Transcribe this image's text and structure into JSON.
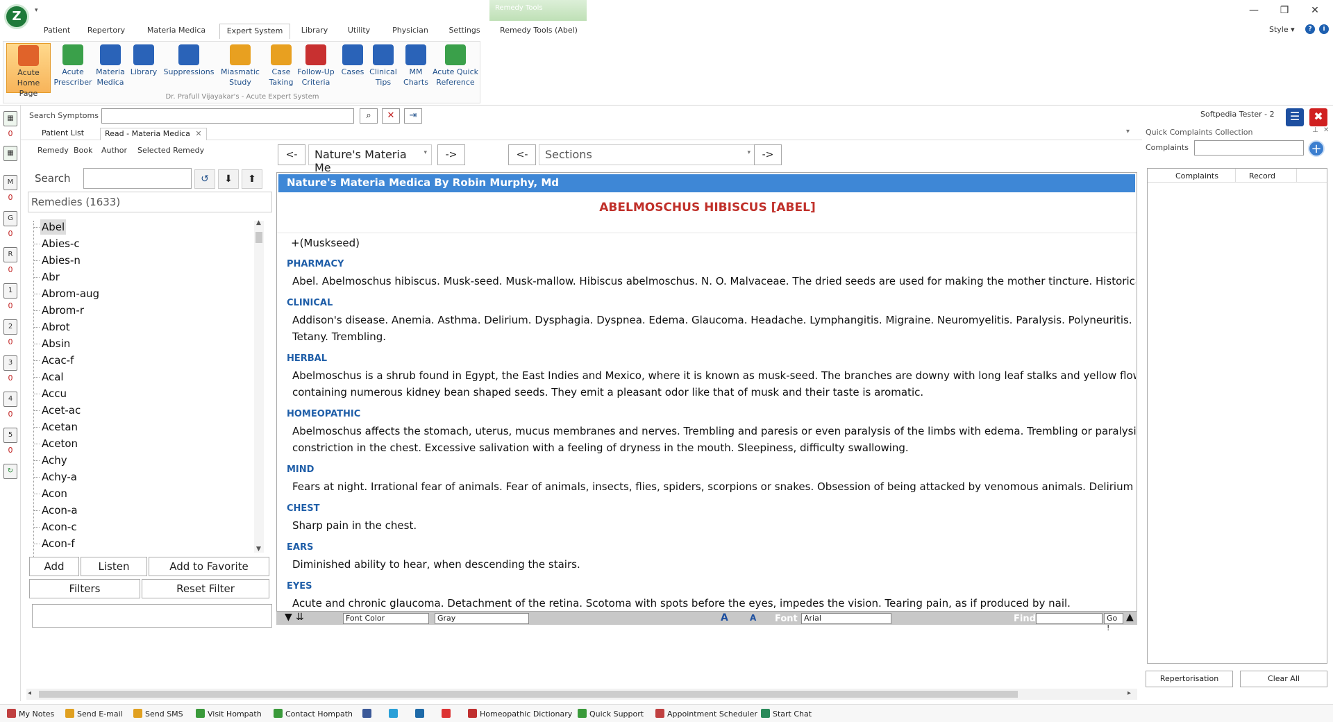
{
  "app": {
    "menu_tabs": [
      "Patient",
      "Repertory",
      "Materia Medica",
      "Expert System",
      "Library",
      "Utility",
      "Physician",
      "Settings",
      "Remedy Tools (Abel)"
    ],
    "active_tab": "Expert System",
    "context_group": "Remedy Tools",
    "style_label": "Style",
    "window_controls": [
      "minimize-icon",
      "restore-icon",
      "close-icon"
    ]
  },
  "ribbon": {
    "buttons": [
      {
        "label": "Acute\nHome Page",
        "icon": "home-page-icon",
        "color": "#e0632a"
      },
      {
        "label": "Acute\nPrescriber",
        "icon": "prescriber-icon",
        "color": "#3aa04a"
      },
      {
        "label": "Materia\nMedica",
        "icon": "materia-medica-icon",
        "color": "#2a63b8"
      },
      {
        "label": "Library",
        "icon": "library-icon",
        "color": "#2a63b8"
      },
      {
        "label": "Suppressions",
        "icon": "suppressions-icon",
        "color": "#2a63b8"
      },
      {
        "label": "Miasmatic\nStudy",
        "icon": "miasmatic-icon",
        "color": "#e8a020"
      },
      {
        "label": "Case\nTaking",
        "icon": "case-taking-icon",
        "color": "#e8a020"
      },
      {
        "label": "Follow-Up\nCriteria",
        "icon": "follow-up-icon",
        "color": "#c83030"
      },
      {
        "label": "Cases",
        "icon": "cases-icon",
        "color": "#2a63b8"
      },
      {
        "label": "Clinical\nTips",
        "icon": "clinical-tips-icon",
        "color": "#2a63b8"
      },
      {
        "label": "MM\nCharts",
        "icon": "mm-charts-icon",
        "color": "#2a63b8"
      },
      {
        "label": "Acute Quick\nReference",
        "icon": "quick-reference-icon",
        "color": "#3aa04a"
      }
    ],
    "caption": "Dr. Prafull Vijayakar's - Acute Expert System"
  },
  "search_symptoms": {
    "label": "Search Symptoms",
    "value": "",
    "user": "Softpedia Tester - 2"
  },
  "left_bar_counts": [
    "0",
    "0",
    "0",
    "0",
    "0",
    "0",
    "0",
    "0",
    "0"
  ],
  "left_bar_icons": [
    "M",
    "G",
    "R",
    "1",
    "2",
    "3",
    "4",
    "5"
  ],
  "doc_tabs": [
    "Patient List",
    "Read - Materia Medica"
  ],
  "sub_tabs": [
    "Remedy",
    "Book",
    "Author",
    "Selected Remedy"
  ],
  "left_panel": {
    "search_label": "Search",
    "remedies_header": "Remedies (1633)",
    "remedies": [
      "Abel",
      "Abies-c",
      "Abies-n",
      "Abr",
      "Abrom-aug",
      "Abrom-r",
      "Abrot",
      "Absin",
      "Acac-f",
      "Acal",
      "Accu",
      "Acet-ac",
      "Acetan",
      "Aceton",
      "Achy",
      "Achy-a",
      "Acon",
      "Acon-a",
      "Acon-c",
      "Acon-f"
    ],
    "selected": "Abel",
    "buttons": {
      "add": "Add",
      "listen": "Listen",
      "favorite": "Add to Favorite",
      "filters": "Filters",
      "reset": "Reset Filter"
    }
  },
  "viewer_nav": {
    "prev": "<-",
    "next": "->",
    "book": "Nature's Materia Me",
    "sections": "Sections"
  },
  "document": {
    "header": "Nature's Materia Medica By Robin Murphy, Md",
    "title": "ABELMOSCHUS HIBISCUS [ABEL]",
    "synonym": "+(Muskseed)",
    "sections": [
      {
        "heading": "PHARMACY",
        "lines": [
          "Abel. Abelmoschus hibiscus. Musk-seed. Musk-mallow. Hibiscus abelmoschus. N. O. Malvaceae. The dried seeds are used for making the mother tincture. Historical dose: Tinct"
        ]
      },
      {
        "heading": "CLINICAL",
        "lines": [
          "Addison's disease. Anemia. Asthma. Delirium. Dysphagia. Dyspnea. Edema. Glaucoma. Headache. Lymphangitis. Migraine. Neuromyelitis. Paralysis. Polyneuritis. Ptyalism",
          "Tetany. Trembling."
        ]
      },
      {
        "heading": "HERBAL",
        "lines": [
          "Abelmoschus is a shrub found in Egypt, the East Indies and Mexico, where it is known as musk-seed. The branches are downy with long leaf stalks and yellow flowers. The",
          "containing numerous kidney bean shaped seeds. They emit a pleasant odor like that of musk and their taste is aromatic."
        ]
      },
      {
        "heading": "HOMEOPATHIC",
        "lines": [
          "Abelmoschus affects the stomach, uterus, mucus membranes and nerves. Trembling and paresis or even paralysis of the limbs with edema. Trembling or paralysis of th",
          "constriction in the chest. Excessive salivation with a feeling of dryness in the mouth. Sleepiness, difficulty swallowing."
        ]
      },
      {
        "heading": "MIND",
        "lines": [
          "Fears at night. Irrational fear of animals. Fear of animals, insects, flies, spiders, scorpions or snakes. Obsession of being attacked by venomous animals. Delirium with hallucinat"
        ]
      },
      {
        "heading": "CHEST",
        "lines": [
          "Sharp pain in the chest."
        ]
      },
      {
        "heading": "EARS",
        "lines": [
          "Diminished ability to hear, when descending the stairs."
        ]
      },
      {
        "heading": "EYES",
        "lines": [
          "Acute and chronic glaucoma. Detachment of the retina. Scotoma with spots before the eyes, impedes the vision. Tearing pain, as if produced by nail."
        ]
      }
    ]
  },
  "format_bar": {
    "font_color": "Font Color",
    "color_value": "Gray",
    "font_label": "Font",
    "font_value": "Arial",
    "find_label": "Find",
    "go": "Go !"
  },
  "right_panel": {
    "title": "Quick Complaints Collection",
    "complaints_label": "Complaints",
    "columns": [
      "Complaints",
      "Record"
    ],
    "repertorisation": "Repertorisation",
    "clear_all": "Clear All"
  },
  "status_bar": [
    {
      "label": "My Notes",
      "color": "#c04040"
    },
    {
      "label": "Send E-mail",
      "color": "#e0a020"
    },
    {
      "label": "Send SMS",
      "color": "#e0a020"
    },
    {
      "label": "Visit Hompath",
      "color": "#3a9a3a"
    },
    {
      "label": "Contact Hompath",
      "color": "#3a9a3a"
    },
    {
      "label": "",
      "color": "#3b5998"
    },
    {
      "label": "",
      "color": "#2aa0d8"
    },
    {
      "label": "",
      "color": "#1e6aa8"
    },
    {
      "label": "",
      "color": "#d33"
    },
    {
      "label": "Homeopathic Dictionary",
      "color": "#c03030"
    },
    {
      "label": "Quick Support",
      "color": "#3a9a3a"
    },
    {
      "label": "Appointment Scheduler",
      "color": "#c04040"
    },
    {
      "label": "Start Chat",
      "color": "#2a8a5a"
    }
  ]
}
